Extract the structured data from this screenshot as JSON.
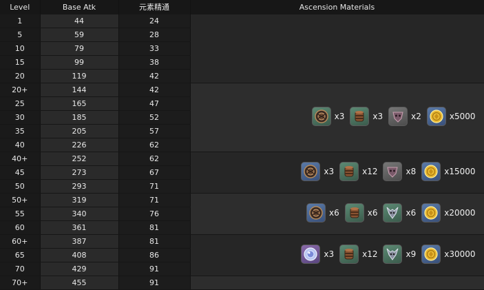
{
  "headers": {
    "level": "Level",
    "atk": "Base Atk",
    "sub": "元素精通",
    "materials": "Ascension Materials"
  },
  "rows": [
    {
      "level": "1",
      "atk": "44",
      "sub": "24"
    },
    {
      "level": "5",
      "atk": "59",
      "sub": "28"
    },
    {
      "level": "10",
      "atk": "79",
      "sub": "33"
    },
    {
      "level": "15",
      "atk": "99",
      "sub": "38"
    },
    {
      "level": "20",
      "atk": "119",
      "sub": "42"
    },
    {
      "level": "20+",
      "atk": "144",
      "sub": "42"
    },
    {
      "level": "25",
      "atk": "165",
      "sub": "47"
    },
    {
      "level": "30",
      "atk": "185",
      "sub": "52"
    },
    {
      "level": "35",
      "atk": "205",
      "sub": "57"
    },
    {
      "level": "40",
      "atk": "226",
      "sub": "62"
    },
    {
      "level": "40+",
      "atk": "252",
      "sub": "62"
    },
    {
      "level": "45",
      "atk": "273",
      "sub": "67"
    },
    {
      "level": "50",
      "atk": "293",
      "sub": "71"
    },
    {
      "level": "50+",
      "atk": "319",
      "sub": "71"
    },
    {
      "level": "55",
      "atk": "340",
      "sub": "76"
    },
    {
      "level": "60",
      "atk": "361",
      "sub": "81"
    },
    {
      "level": "60+",
      "atk": "387",
      "sub": "81"
    },
    {
      "level": "65",
      "atk": "408",
      "sub": "86"
    },
    {
      "level": "70",
      "atk": "429",
      "sub": "91"
    },
    {
      "level": "70+",
      "atk": "455",
      "sub": "91"
    }
  ],
  "ascensions": [
    {
      "start": 0,
      "span": 5,
      "items": []
    },
    {
      "start": 5,
      "span": 5,
      "items": [
        {
          "icon": "chaos-gear-icon",
          "quality": "q2",
          "qty": "x3"
        },
        {
          "icon": "cylinder-icon",
          "quality": "q2",
          "qty": "x3"
        },
        {
          "icon": "mask-icon",
          "quality": "q1",
          "qty": "x2"
        },
        {
          "icon": "mora-coin-icon",
          "quality": "q3",
          "qty": "x5000"
        }
      ]
    },
    {
      "start": 10,
      "span": 3,
      "items": [
        {
          "icon": "chaos-gear-icon",
          "quality": "q3",
          "qty": "x3"
        },
        {
          "icon": "cylinder-icon",
          "quality": "q2",
          "qty": "x12"
        },
        {
          "icon": "mask-icon",
          "quality": "q1",
          "qty": "x8"
        },
        {
          "icon": "mora-coin-icon",
          "quality": "q3",
          "qty": "x15000"
        }
      ]
    },
    {
      "start": 13,
      "span": 3,
      "items": [
        {
          "icon": "chaos-gear-icon",
          "quality": "q3",
          "qty": "x6"
        },
        {
          "icon": "cylinder-icon",
          "quality": "q2",
          "qty": "x6"
        },
        {
          "icon": "horned-mask-icon",
          "quality": "q2",
          "qty": "x6"
        },
        {
          "icon": "mora-coin-icon",
          "quality": "q3",
          "qty": "x20000"
        }
      ]
    },
    {
      "start": 16,
      "span": 3,
      "items": [
        {
          "icon": "crystal-orb-icon",
          "quality": "q4",
          "qty": "x3"
        },
        {
          "icon": "cylinder-icon",
          "quality": "q2",
          "qty": "x12"
        },
        {
          "icon": "horned-mask-icon",
          "quality": "q2",
          "qty": "x9"
        },
        {
          "icon": "mora-coin-icon",
          "quality": "q3",
          "qty": "x30000"
        }
      ]
    },
    {
      "start": 19,
      "span": 1,
      "items": []
    }
  ]
}
